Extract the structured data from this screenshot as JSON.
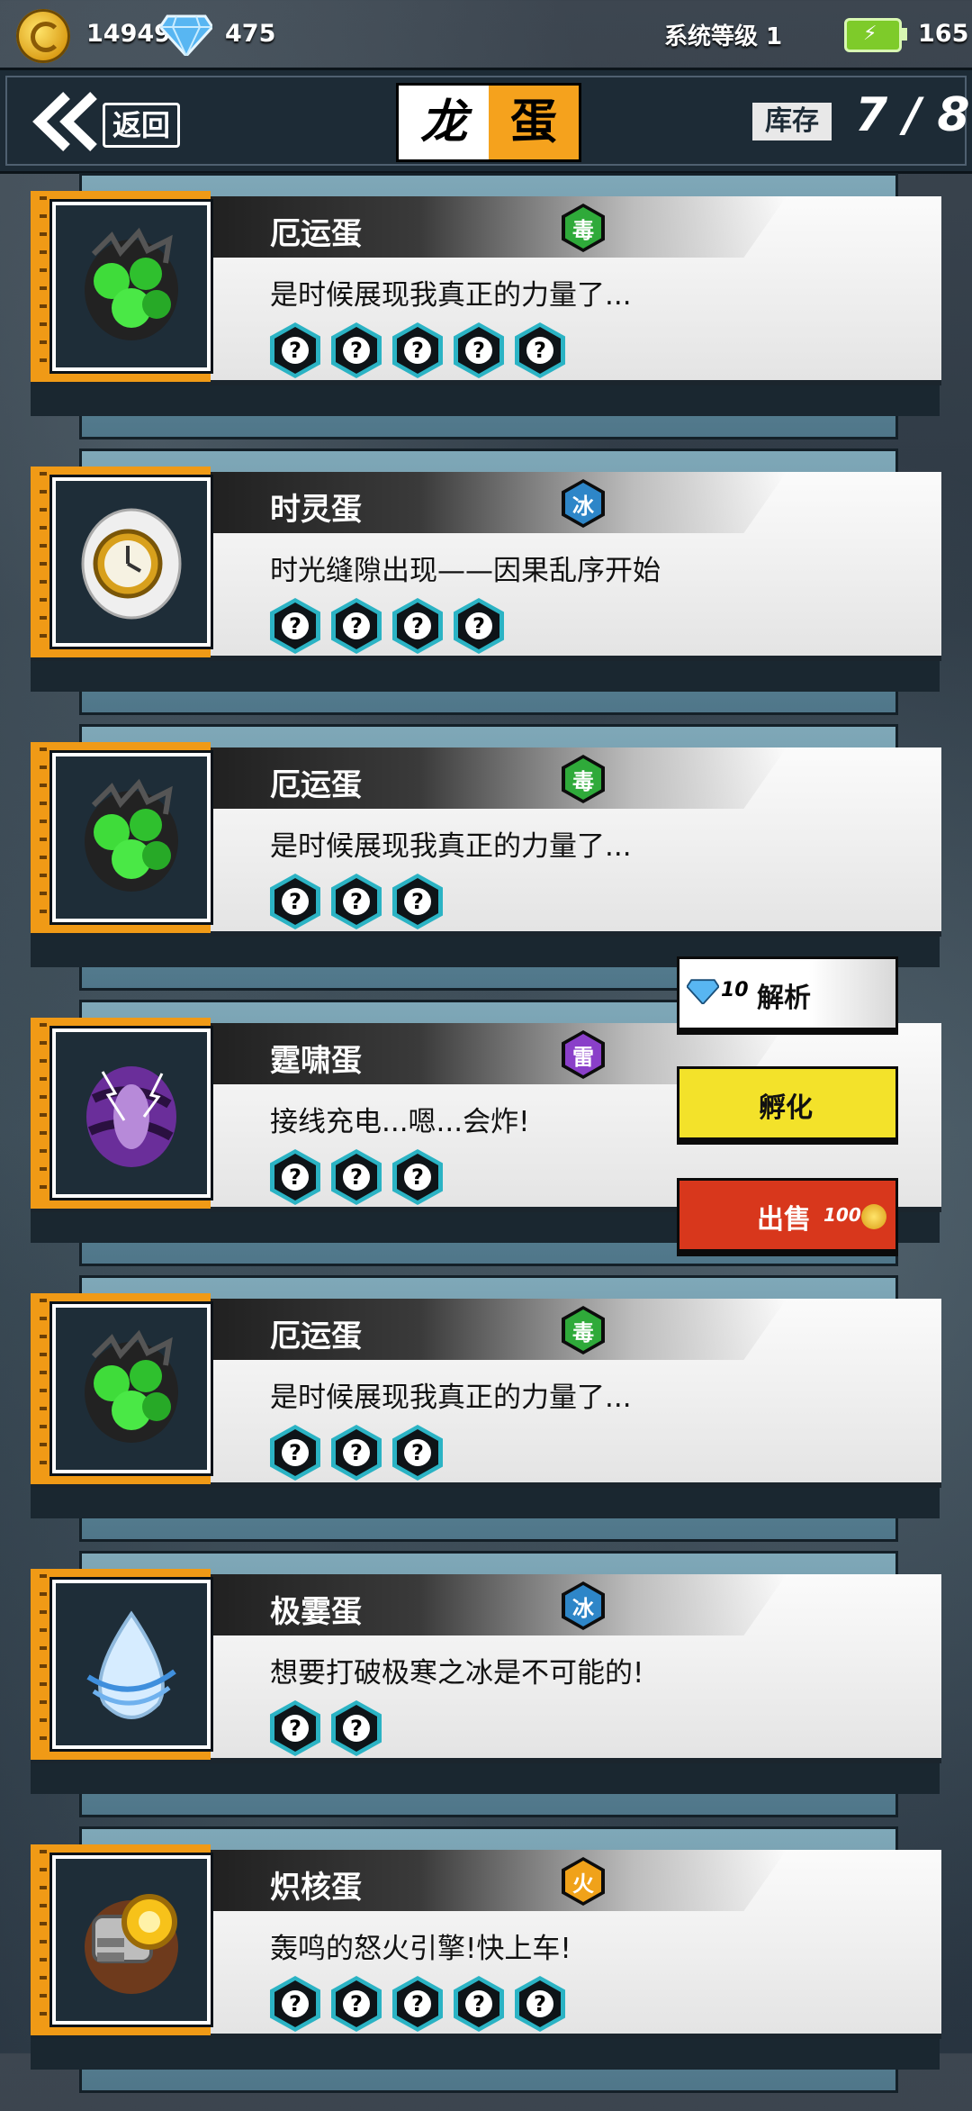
{
  "topbar": {
    "coins": "14949",
    "gems": "475",
    "system_level": "系统等级 1",
    "energy": "165"
  },
  "header": {
    "back_label": "返回",
    "title_part1": "龙",
    "title_part2": "蛋",
    "stock_label": "库存",
    "stock_value": "7 / 8"
  },
  "eggs": [
    {
      "name": "厄运蛋",
      "element": "毒",
      "element_color": "#2faa3a",
      "description": "是时候展现我真正的力量了...",
      "slots": 5,
      "art": "green-spore-egg"
    },
    {
      "name": "时灵蛋",
      "element": "冰",
      "element_color": "#2e86c8",
      "description": "时光缝隙出现——因果乱序开始",
      "slots": 4,
      "art": "clock-egg"
    },
    {
      "name": "厄运蛋",
      "element": "毒",
      "element_color": "#2faa3a",
      "description": "是时候展现我真正的力量了...",
      "slots": 3,
      "art": "green-spore-egg"
    },
    {
      "name": "霆啸蛋",
      "element": "雷",
      "element_color": "#8a3fc9",
      "description": "接线充电...嗯...会炸!",
      "slots": 3,
      "art": "thunder-egg"
    },
    {
      "name": "厄运蛋",
      "element": "毒",
      "element_color": "#2faa3a",
      "description": "是时候展现我真正的力量了...",
      "slots": 3,
      "art": "green-spore-egg"
    },
    {
      "name": "极霎蛋",
      "element": "冰",
      "element_color": "#2e86c8",
      "description": "想要打破极寒之冰是不可能的!",
      "slots": 2,
      "art": "ice-drop-egg"
    },
    {
      "name": "炽核蛋",
      "element": "火",
      "element_color": "#f0a21a",
      "description": "轰鸣的怒火引擎!快上车!",
      "slots": 5,
      "art": "engine-egg"
    }
  ],
  "actions": {
    "analyze_cost": "10",
    "analyze_label": "解析",
    "hatch_label": "孵化",
    "sell_label": "出售",
    "sell_price": "100"
  }
}
